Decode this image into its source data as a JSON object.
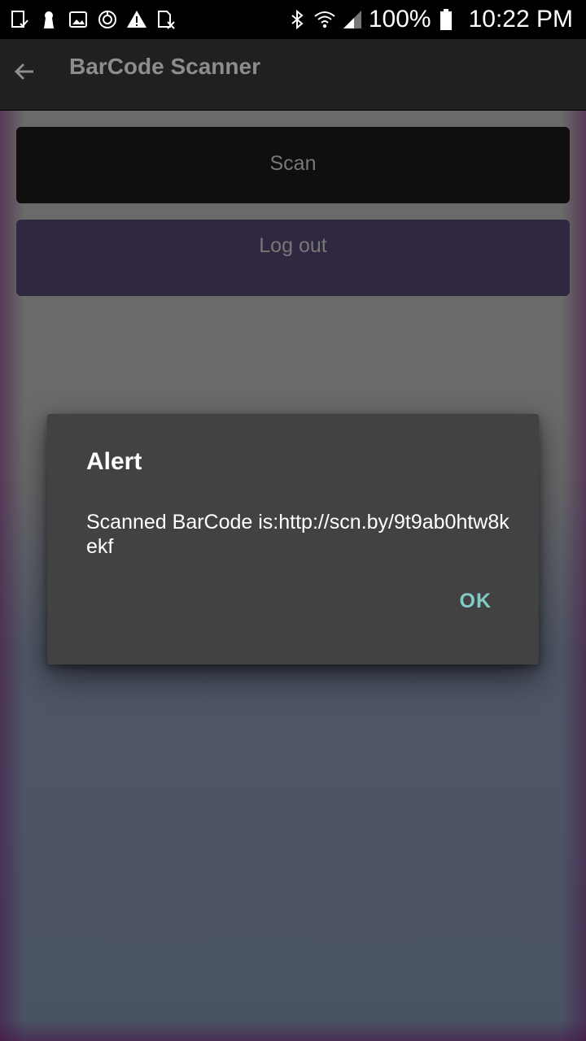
{
  "status_bar": {
    "left_icons": [
      "download-complete-icon",
      "keyhole-icon",
      "image-icon",
      "sync-icon",
      "warning-icon",
      "sim-off-icon"
    ],
    "right_icons": [
      "bluetooth-icon",
      "wifi-icon",
      "cell-signal-icon",
      "battery-icon"
    ],
    "battery_text": "100%",
    "time": "10:22 PM"
  },
  "toolbar": {
    "back_icon": "arrow-left-icon",
    "title": "BarCode Scanner"
  },
  "buttons": {
    "scan_label": "Scan",
    "logout_label": "Log out"
  },
  "dialog": {
    "title": "Alert",
    "message": "Scanned BarCode is:http://scn.by/9t9ab0htw8kekf",
    "ok_label": "OK"
  },
  "colors": {
    "toolbar_bg": "#202020",
    "scan_button_bg": "#0f0f0f",
    "logout_button_bg": "#2f2840",
    "dialog_bg": "#424242",
    "accent_ok": "#80cbc4"
  }
}
